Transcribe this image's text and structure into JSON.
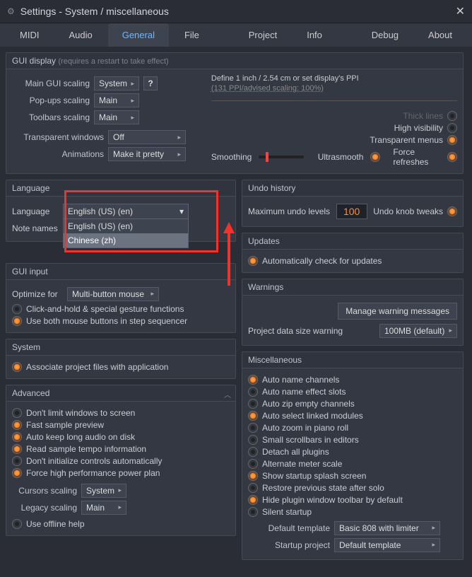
{
  "window": {
    "title": "Settings - System / miscellaneous"
  },
  "tabs": {
    "midi": "MIDI",
    "audio": "Audio",
    "general": "General",
    "file": "File",
    "project": "Project",
    "info": "Info",
    "debug": "Debug",
    "about": "About"
  },
  "gui_display": {
    "header": "GUI display",
    "hint": "(requires a restart to take effect)",
    "main_scaling_label": "Main GUI scaling",
    "main_scaling_value": "System",
    "ppi_line1": "Define 1 inch / 2.54 cm or set display's PPI",
    "ppi_line2": "(131 PPI/advised scaling: 100%)",
    "popups_label": "Pop-ups scaling",
    "popups_value": "Main",
    "toolbars_label": "Toolbars scaling",
    "toolbars_value": "Main",
    "transparent_label": "Transparent windows",
    "transparent_value": "Off",
    "animations_label": "Animations",
    "animations_value": "Make it pretty",
    "smoothing": "Smoothing",
    "thick_lines": "Thick lines",
    "high_visibility": "High visibility",
    "transparent_menus": "Transparent menus",
    "ultrasmooth": "Ultrasmooth",
    "force_refreshes": "Force refreshes"
  },
  "language": {
    "header": "Language",
    "lang_label": "Language",
    "selected": "English (US) (en)",
    "opt1": "English (US) (en)",
    "opt2": "Chinese (zh)",
    "note_names_label": "Note names"
  },
  "gui_input": {
    "header": "GUI input",
    "optimize_label": "Optimize for",
    "optimize_value": "Multi-button mouse",
    "click_hold": "Click-and-hold & special gesture functions",
    "both_mouse": "Use both mouse buttons in step sequencer"
  },
  "system": {
    "header": "System",
    "associate": "Associate project files with application"
  },
  "advanced": {
    "header": "Advanced",
    "limit_windows": "Don't limit windows to screen",
    "fast_preview": "Fast sample preview",
    "auto_keep": "Auto keep long audio on disk",
    "read_tempo": "Read sample tempo information",
    "dont_init": "Don't initialize controls automatically",
    "force_power": "Force high performance power plan",
    "cursors_label": "Cursors scaling",
    "cursors_value": "System",
    "legacy_label": "Legacy scaling",
    "legacy_value": "Main",
    "offline_help": "Use offline help"
  },
  "undo": {
    "header": "Undo history",
    "max_label": "Maximum undo levels",
    "max_value": "100",
    "knob_tweaks": "Undo knob tweaks"
  },
  "updates": {
    "header": "Updates",
    "auto_check": "Automatically check for updates"
  },
  "warnings": {
    "header": "Warnings",
    "manage_btn": "Manage warning messages",
    "size_label": "Project data size warning",
    "size_value": "100MB (default)"
  },
  "misc": {
    "header": "Miscellaneous",
    "auto_name_ch": "Auto name channels",
    "auto_name_fx": "Auto name effect slots",
    "auto_zip": "Auto zip empty channels",
    "auto_select": "Auto select linked modules",
    "auto_zoom": "Auto zoom in piano roll",
    "small_scroll": "Small scrollbars in editors",
    "detach": "Detach all plugins",
    "alt_meter": "Alternate meter scale",
    "splash": "Show startup splash screen",
    "restore_solo": "Restore previous state after solo",
    "hide_toolbar": "Hide plugin window toolbar by default",
    "silent_startup": "Silent startup",
    "def_tmpl_label": "Default template",
    "def_tmpl_value": "Basic 808 with limiter",
    "startup_label": "Startup project",
    "startup_value": "Default template"
  }
}
